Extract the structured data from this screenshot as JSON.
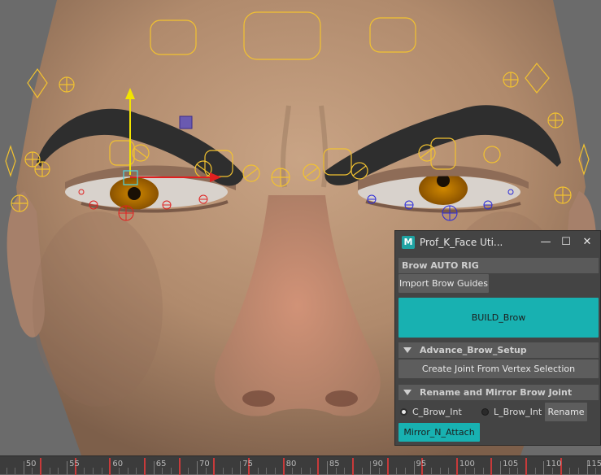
{
  "window": {
    "title": "Prof_K_Face Uti...",
    "logo_letter": "M",
    "minimize_glyph": "—",
    "maximize_glyph": "☐",
    "close_glyph": "✕"
  },
  "brow_auto_rig": {
    "header": "Brow AUTO RIG",
    "import_button": "Import Brow Guides",
    "build_button": "BUILD_Brow",
    "build_color": "#18b1b1"
  },
  "advance_setup": {
    "header": "Advance_Brow_Setup",
    "create_joint_button": "Create Joint From Vertex Selection"
  },
  "rename_mirror": {
    "header": "Rename and Mirror Brow Joint",
    "radio_c_label": "C_Brow_Int",
    "radio_c_selected": true,
    "radio_l_label": "L_Brow_Int",
    "radio_l_selected": false,
    "rename_button": "Rename",
    "mirror_button": "Mirror_N_Attach",
    "mirror_color": "#18b1b1"
  },
  "timeline": {
    "labels": [
      "50",
      "55",
      "60",
      "65",
      "70",
      "75",
      "80",
      "85",
      "90",
      "95",
      "100",
      "105",
      "110",
      "115"
    ],
    "key_frames": [
      52,
      56,
      60,
      64,
      68,
      72,
      76,
      80,
      84,
      88,
      92,
      96,
      100,
      104,
      108,
      112
    ]
  },
  "colors": {
    "control_yellow": "#f2c230",
    "control_red": "#e02020",
    "control_blue": "#2a2ad8",
    "selection_cyan": "#4fd8e0",
    "panel_accent": "#18b1b1"
  }
}
